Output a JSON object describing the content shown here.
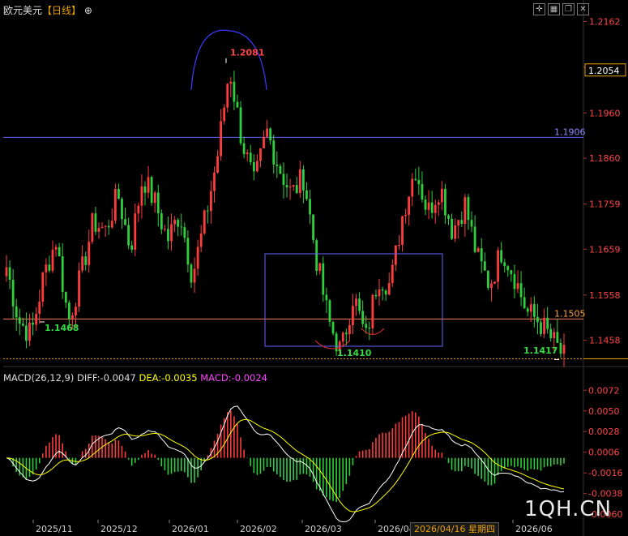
{
  "header": {
    "symbol": "欧元美元",
    "timeframe": "【日线】",
    "target_icon": "⊕"
  },
  "toolbar": [
    "crosshair-icon",
    "layout-icon",
    "restore-icon",
    "close-icon"
  ],
  "price_axis": {
    "ticks": [
      "1.2162",
      "1.2061",
      "1.1960",
      "1.1860",
      "1.1759",
      "1.1659",
      "1.1558",
      "1.1458"
    ],
    "current": "1.2054"
  },
  "annotations": {
    "high": "1.2081",
    "low_start": "1.1468",
    "low_mid": "1.1410",
    "low_end": "1.1417",
    "h_line_blue": "1.1906",
    "h_line_orange": "1.1505"
  },
  "macd": {
    "label": "MACD(26,12,9)",
    "diff": "DIFF:-0.0047",
    "dea": "DEA:-0.0035",
    "macd": "MACD:-0.0024",
    "ticks": [
      "0.0072",
      "0.0050",
      "0.0028",
      "0.0006",
      "-0.0016",
      "-0.0038",
      "-0.0060"
    ]
  },
  "x_axis": {
    "labels": [
      "2025/11",
      "2025/12",
      "2026/01",
      "2026/02",
      "2026/03",
      "2026/04",
      "2026/06"
    ],
    "cursor_date": "2026/04/16 星期四"
  },
  "watermark": "1QH.CN",
  "colors": {
    "up": "#ff3b3b",
    "down": "#2ed13b",
    "blue_line": "#6464ff",
    "orange_line": "#ff7f50",
    "diff": "#ffffff",
    "dea": "#ffff00"
  },
  "chart_data": {
    "type": "candlestick",
    "ohlc_close_path": [
      1.162,
      1.15,
      1.147,
      1.16,
      1.168,
      1.15,
      1.16,
      1.172,
      1.17,
      1.178,
      1.166,
      1.182,
      1.176,
      1.168,
      1.174,
      1.16,
      1.172,
      1.186,
      1.206,
      1.19,
      1.18,
      1.192,
      1.184,
      1.178,
      1.182,
      1.164,
      1.15,
      1.143,
      1.156,
      1.146,
      1.16,
      1.158,
      1.174,
      1.184,
      1.174,
      1.18,
      1.17,
      1.176,
      1.164,
      1.158,
      1.166,
      1.16,
      1.152,
      1.15,
      1.146,
      1.142
    ],
    "price_ylim": [
      1.14,
      1.217
    ],
    "macd_ylim": [
      -0.0065,
      0.008
    ]
  }
}
